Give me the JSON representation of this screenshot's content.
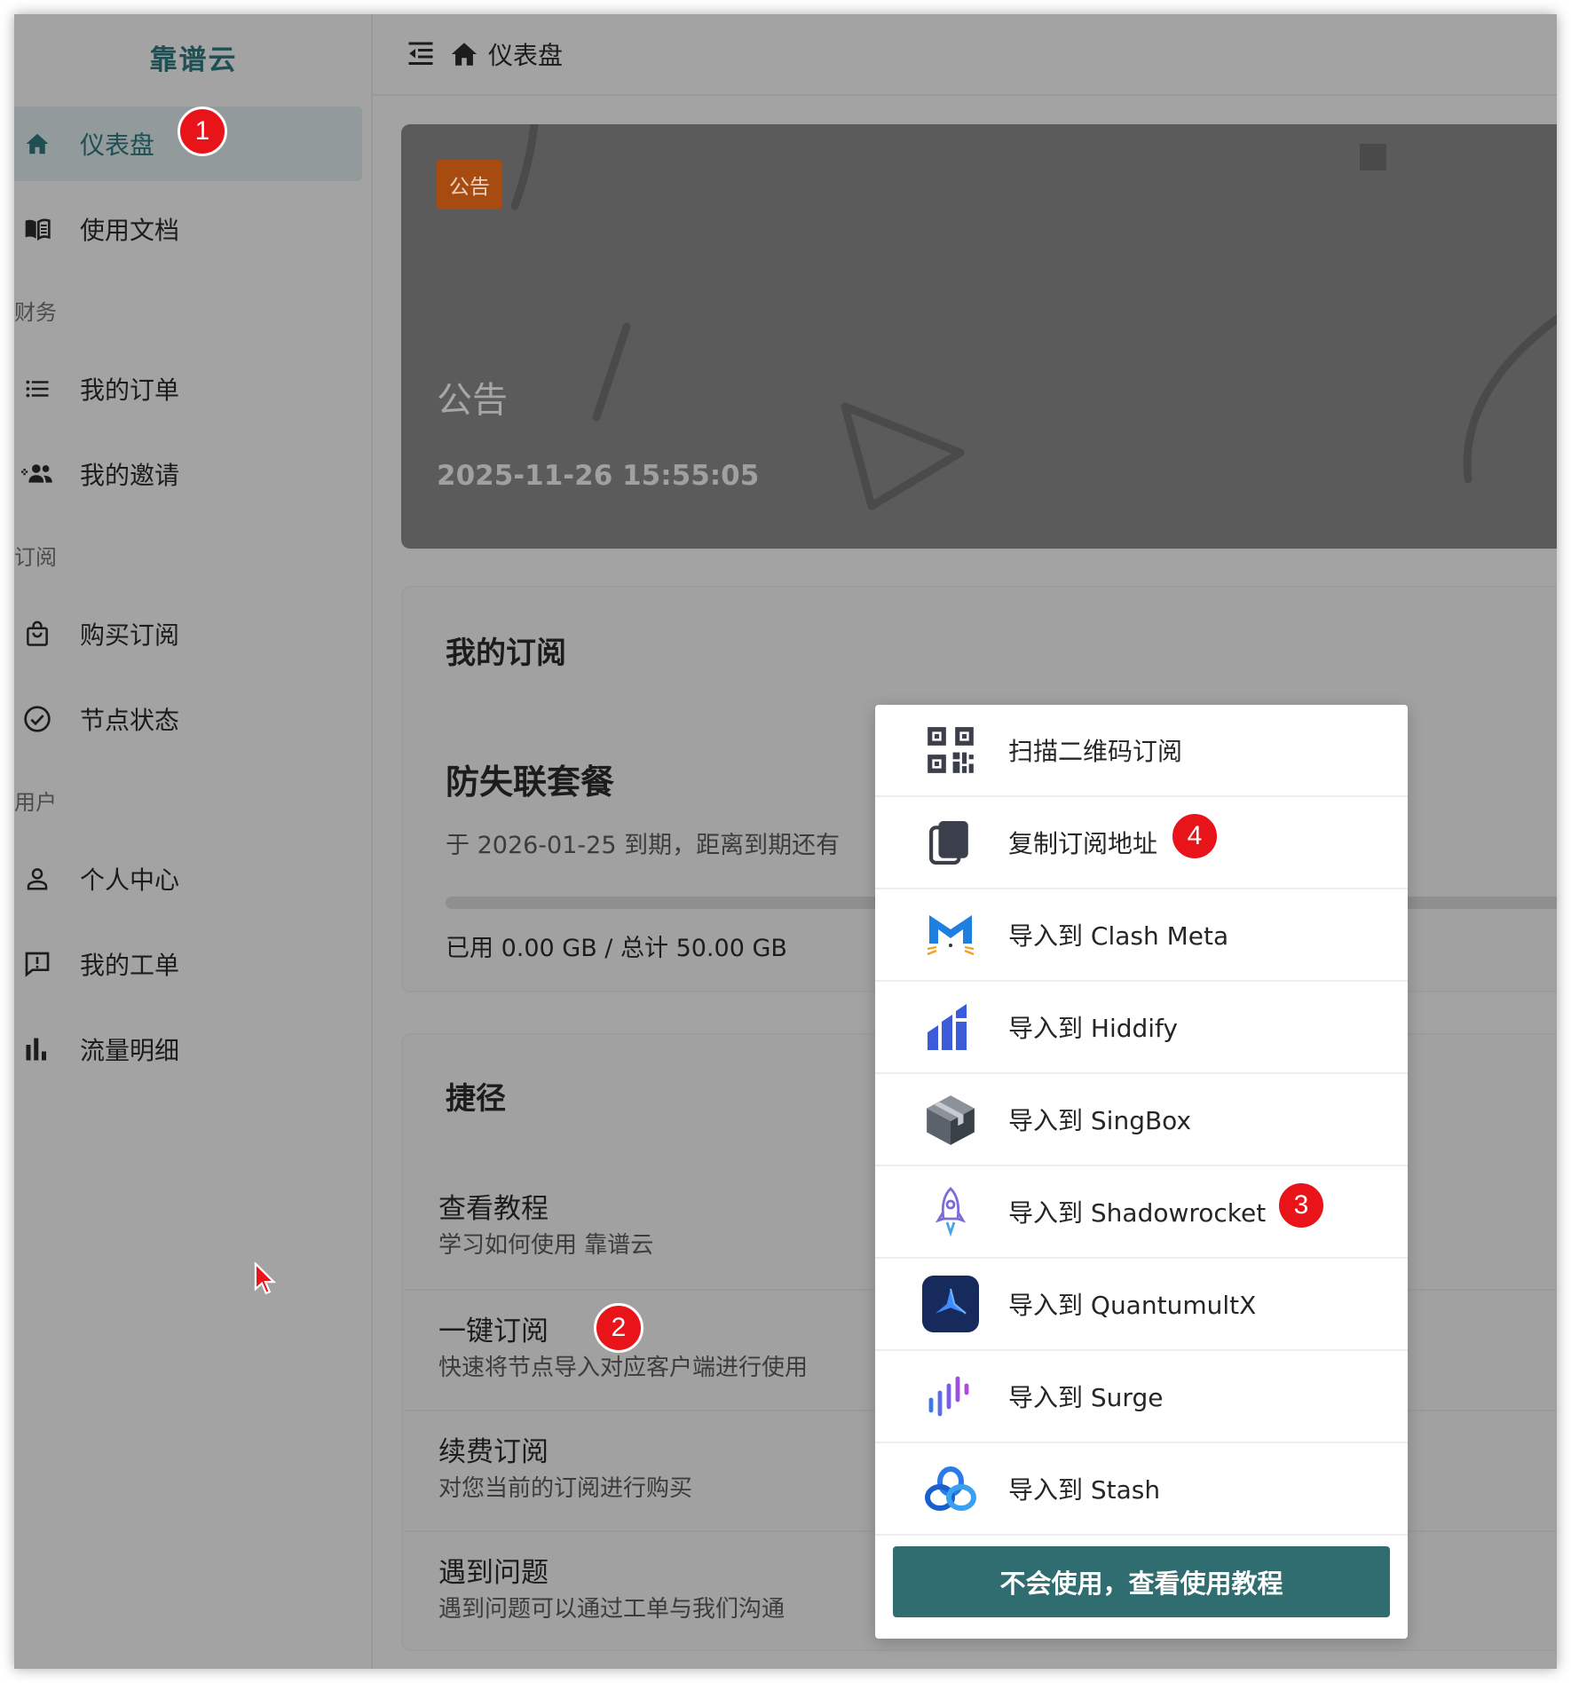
{
  "app": {
    "brand": "靠谱云"
  },
  "sidebar": {
    "items": [
      {
        "label": "仪表盘",
        "icon": "home-icon",
        "active": true
      },
      {
        "label": "使用文档",
        "icon": "book-icon"
      },
      {
        "label": "我的订单",
        "icon": "list-icon"
      },
      {
        "label": "我的邀请",
        "icon": "user-plus-icon"
      },
      {
        "label": "购买订阅",
        "icon": "shopping-bag-icon"
      },
      {
        "label": "节点状态",
        "icon": "check-circle-icon"
      },
      {
        "label": "个人中心",
        "icon": "user-icon"
      },
      {
        "label": "我的工单",
        "icon": "message-alert-icon"
      },
      {
        "label": "流量明细",
        "icon": "bar-chart-icon"
      }
    ],
    "sections": [
      "财务",
      "订阅",
      "用户"
    ]
  },
  "header": {
    "breadcrumb": "仪表盘"
  },
  "notice": {
    "tag": "公告",
    "title": "公告",
    "time": "2025-11-26 15:55:05"
  },
  "subscription": {
    "title": "我的订阅",
    "plan": "防失联套餐",
    "expire_text": "于 2026-01-25 到期，距离到期还有",
    "usage_text": "已用 0.00 GB / 总计 50.00 GB",
    "used_fraction": 0
  },
  "shortcuts": {
    "title": "捷径",
    "items": [
      {
        "title": "查看教程",
        "desc": "学习如何使用 靠谱云"
      },
      {
        "title": "一键订阅",
        "desc": "快速将节点导入对应客户端进行使用"
      },
      {
        "title": "续费订阅",
        "desc": "对您当前的订阅进行购买"
      },
      {
        "title": "遇到问题",
        "desc": "遇到问题可以通过工单与我们沟通"
      }
    ]
  },
  "popup": {
    "items": [
      {
        "label": "扫描二维码订阅",
        "icon": "qr-code-icon"
      },
      {
        "label": "复制订阅地址",
        "icon": "copy-icon"
      },
      {
        "label": "导入到 Clash Meta",
        "icon": "clash-meta-icon"
      },
      {
        "label": "导入到 Hiddify",
        "icon": "hiddify-icon"
      },
      {
        "label": "导入到 SingBox",
        "icon": "singbox-icon"
      },
      {
        "label": "导入到 Shadowrocket",
        "icon": "shadowrocket-icon"
      },
      {
        "label": "导入到 QuantumultX",
        "icon": "quantumultx-icon"
      },
      {
        "label": "导入到 Surge",
        "icon": "surge-icon"
      },
      {
        "label": "导入到 Stash",
        "icon": "stash-icon"
      }
    ],
    "tutorial_button": "不会使用，查看使用教程"
  },
  "markers": [
    "1",
    "2",
    "3",
    "4"
  ],
  "colors": {
    "accent": "#1e4f53",
    "button": "#2f6d70",
    "notice_tag": "#a74b10",
    "marker": "#e8141a"
  }
}
